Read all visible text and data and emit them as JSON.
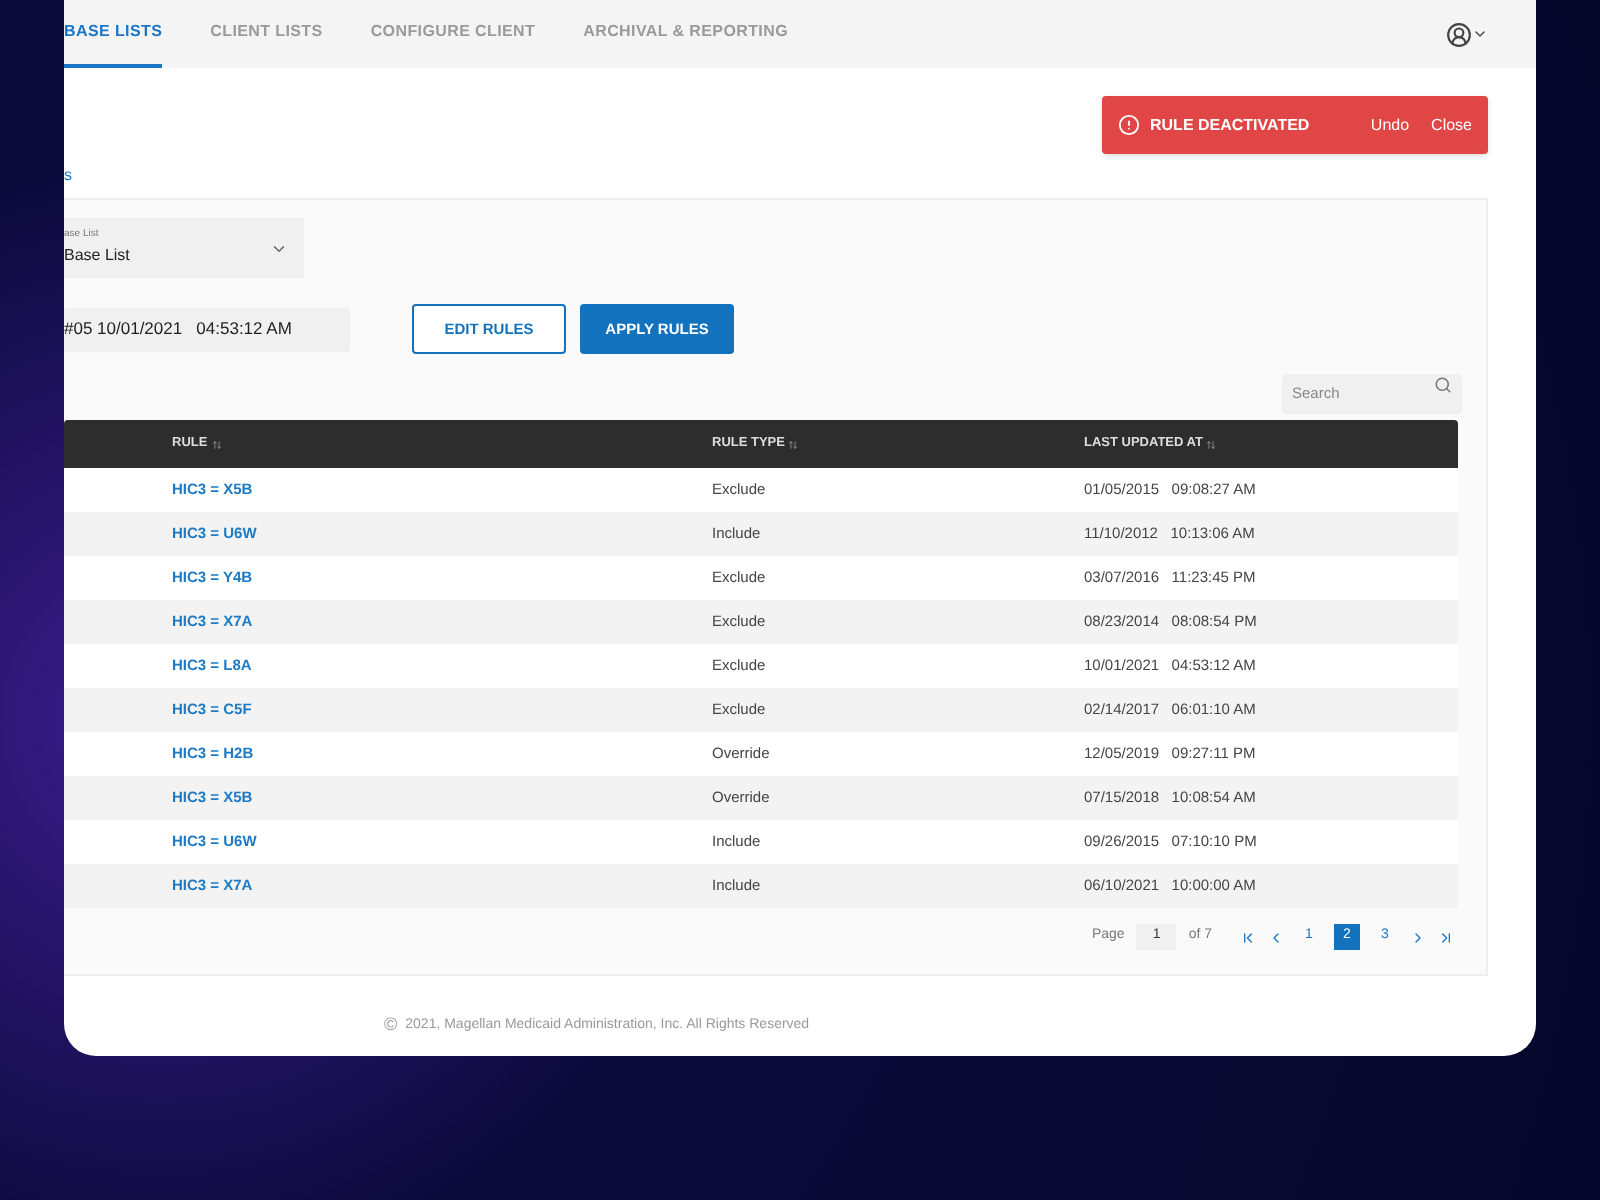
{
  "nav": {
    "tabs": [
      {
        "label": "BASE LISTS",
        "selected": true
      },
      {
        "label": "CLIENT LISTS",
        "selected": false
      },
      {
        "label": "CONFIGURE CLIENT",
        "selected": false
      },
      {
        "label": "ARCHIVAL & REPORTING",
        "selected": false
      }
    ]
  },
  "toast": {
    "message": "RULE DEACTIVATED",
    "actions": [
      "Undo",
      "Close"
    ]
  },
  "breadcrumb": "s",
  "select": {
    "label": "ase List",
    "value": "Base List"
  },
  "version_field": {
    "value": "#05 10/01/2021   04:53:12 AM"
  },
  "buttons": [
    {
      "label": "EDIT RULES",
      "kind": "outline"
    },
    {
      "label": "APPLY RULES",
      "kind": "primary"
    }
  ],
  "search": {
    "placeholder": "Search"
  },
  "table": {
    "columns": [
      "RULE",
      "RULE TYPE",
      "LAST UPDATED AT"
    ],
    "rows": [
      {
        "rule": "HIC3 = X5B",
        "type": "Exclude",
        "updated": "01/05/2015   09:08:27 AM"
      },
      {
        "rule": "HIC3 = U6W",
        "type": "Include",
        "updated": "11/10/2012   10:13:06 AM"
      },
      {
        "rule": "HIC3 = Y4B",
        "type": "Exclude",
        "updated": "03/07/2016   11:23:45 PM"
      },
      {
        "rule": "HIC3 = X7A",
        "type": "Exclude",
        "updated": "08/23/2014   08:08:54 PM"
      },
      {
        "rule": "HIC3 = L8A",
        "type": "Exclude",
        "updated": "10/01/2021   04:53:12 AM"
      },
      {
        "rule": "HIC3 = C5F",
        "type": "Exclude",
        "updated": "02/14/2017   06:01:10 AM"
      },
      {
        "rule": "HIC3 = H2B",
        "type": "Override",
        "updated": "12/05/2019   09:27:11 PM"
      },
      {
        "rule": "HIC3 = X5B",
        "type": "Override",
        "updated": "07/15/2018   10:08:54 AM"
      },
      {
        "rule": "HIC3 = U6W",
        "type": "Include",
        "updated": "09/26/2015   07:10:10 PM"
      },
      {
        "rule": "HIC3 = X7A",
        "type": "Include",
        "updated": "06/10/2021   10:00:00 AM"
      }
    ]
  },
  "pagination": {
    "label": "Page",
    "page_input": "1",
    "total": "of 7",
    "pages": [
      {
        "label": "1",
        "selected": false
      },
      {
        "label": "2",
        "selected": true
      },
      {
        "label": "3",
        "selected": false
      }
    ]
  },
  "footer": {
    "copyright_symbol": "©",
    "text": "2021, Magellan Medicaid Administration, Inc. All Rights Reserved"
  }
}
